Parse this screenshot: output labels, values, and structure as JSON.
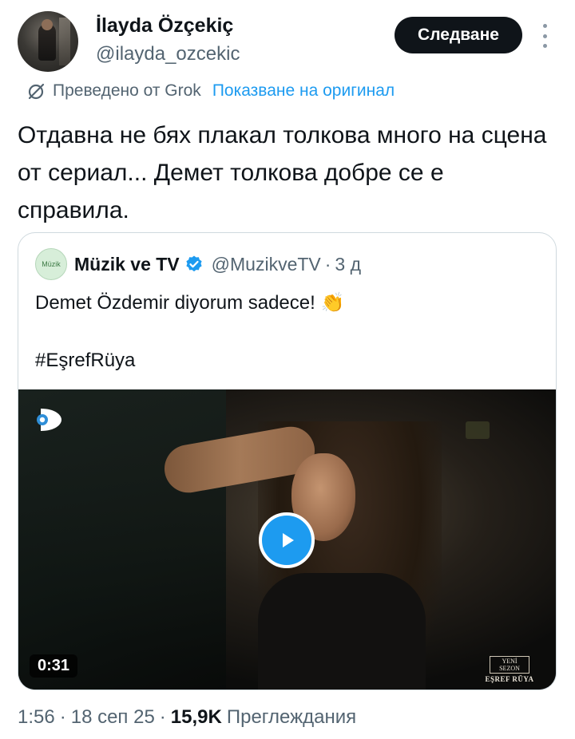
{
  "author": {
    "display_name": "İlayda Özçekiç",
    "handle": "@ilayda_ozcekic",
    "follow_label": "Следване"
  },
  "translation": {
    "translated_by": "Преведено от Grok",
    "show_original": "Показване на оригинал"
  },
  "tweet": {
    "text": "Отдавна не бях плакал толкова много на сцена от сериал... Демет толкова добре се е справила."
  },
  "quoted": {
    "avatar_text": "Müzik",
    "display_name": "Müzik ve TV",
    "handle": "@MuzikveTV",
    "separator": "·",
    "time": "3 д",
    "line1": "Demet Özdemir diyorum sadece!",
    "clap_emoji": "👏",
    "hashtag": "#EşrefRüya",
    "video": {
      "duration": "0:31",
      "badge_line1": "YENİ SEZON",
      "badge_line2": "EŞREF RÜYA"
    }
  },
  "meta": {
    "time": "1:56",
    "date": "18 сеп 25",
    "views_count": "15,9K",
    "views_label": "Преглеждания",
    "separator": "·"
  },
  "colors": {
    "link_blue": "#1d9bf0",
    "text_primary": "#0f1419",
    "text_secondary": "#536471",
    "follow_button_bg": "#0f1419",
    "border": "#cfd9de"
  },
  "icons": {
    "more": "vertical-dots-icon",
    "translate": "slashed-circle-icon",
    "verified": "verified-badge-icon",
    "play": "play-icon",
    "channel": "channel-d-logo"
  }
}
